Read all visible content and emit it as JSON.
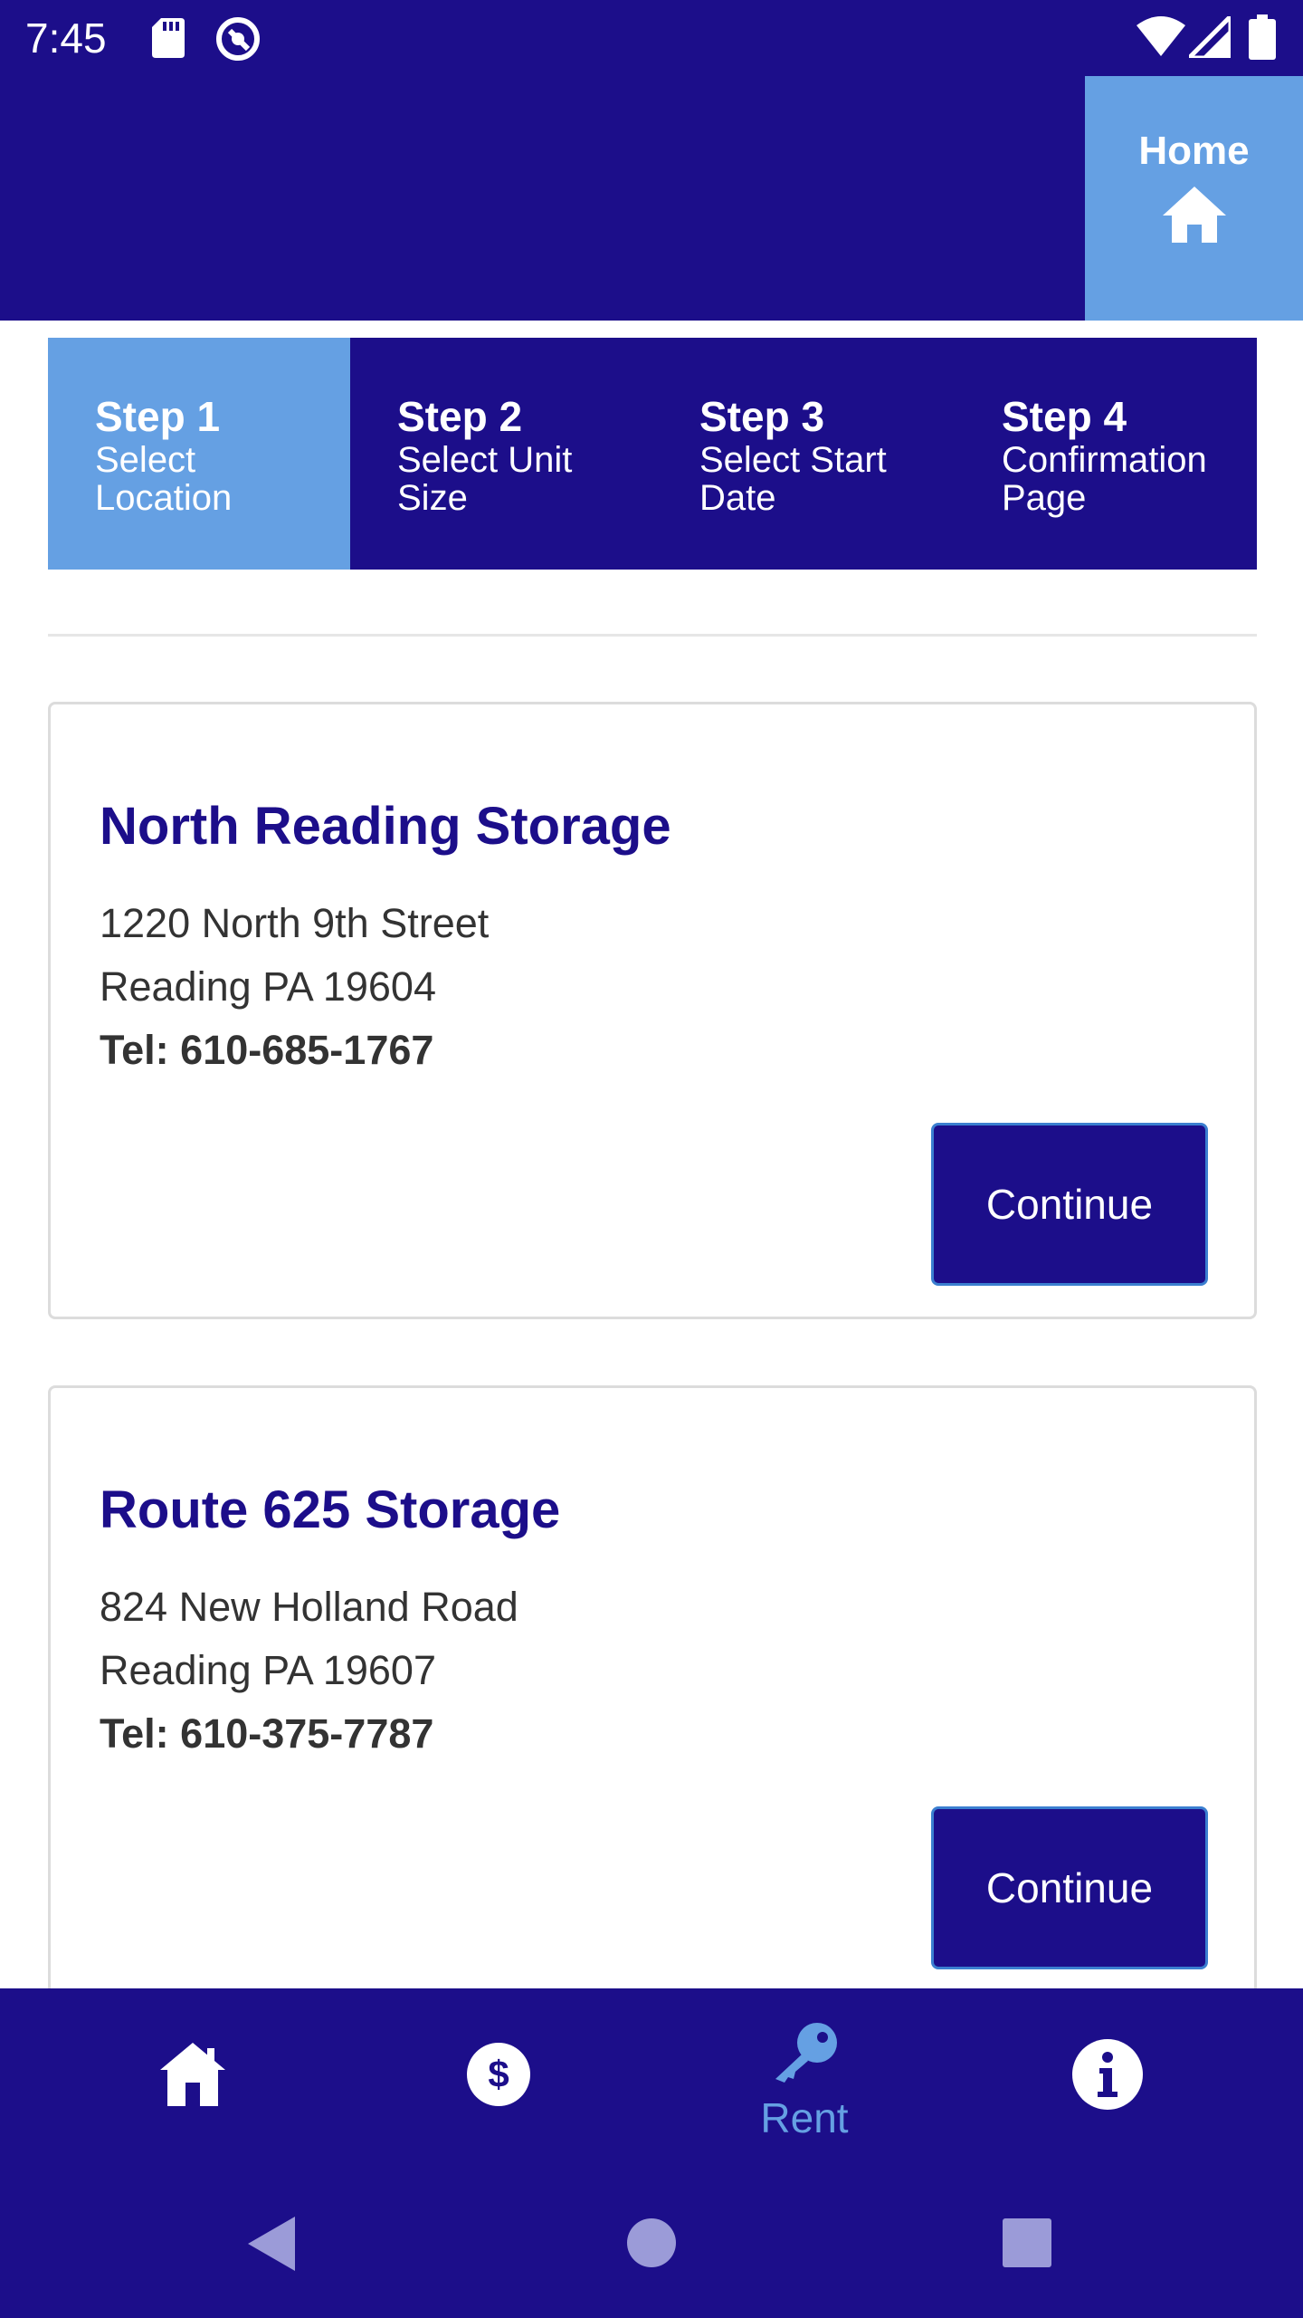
{
  "status_bar": {
    "time": "7:45",
    "icons": [
      "sd-card-icon",
      "sync-icon",
      "wifi-icon",
      "signal-icon",
      "battery-icon"
    ]
  },
  "header": {
    "home_label": "Home",
    "home_icon": "home-icon"
  },
  "steps": [
    {
      "title": "Step 1",
      "subtitle": "Select Location",
      "active": true
    },
    {
      "title": "Step 2",
      "subtitle": "Select Unit Size",
      "active": false
    },
    {
      "title": "Step 3",
      "subtitle": "Select Start Date",
      "active": false
    },
    {
      "title": "Step 4",
      "subtitle": "Confirmation Page",
      "active": false
    }
  ],
  "locations": [
    {
      "name": "North Reading Storage",
      "address_line1": "1220 North 9th Street",
      "address_line2": "Reading PA 19604",
      "tel": "Tel: 610-685-1767",
      "button_label": "Continue"
    },
    {
      "name": "Route 625 Storage",
      "address_line1": "824 New Holland Road",
      "address_line2": "Reading PA 19607",
      "tel": "Tel: 610-375-7787",
      "button_label": "Continue"
    }
  ],
  "bottom_nav": {
    "items": [
      {
        "icon": "home-icon",
        "label": ""
      },
      {
        "icon": "dollar-icon",
        "label": ""
      },
      {
        "icon": "key-icon",
        "label": "Rent",
        "active": true
      },
      {
        "icon": "info-icon",
        "label": ""
      }
    ]
  },
  "system_nav": [
    "back-icon",
    "home-circle-icon",
    "recents-icon"
  ],
  "colors": {
    "primary": "#1c0e8a",
    "accent": "#65a0e3",
    "text": "#333333",
    "card_border": "#dcdcdc"
  }
}
